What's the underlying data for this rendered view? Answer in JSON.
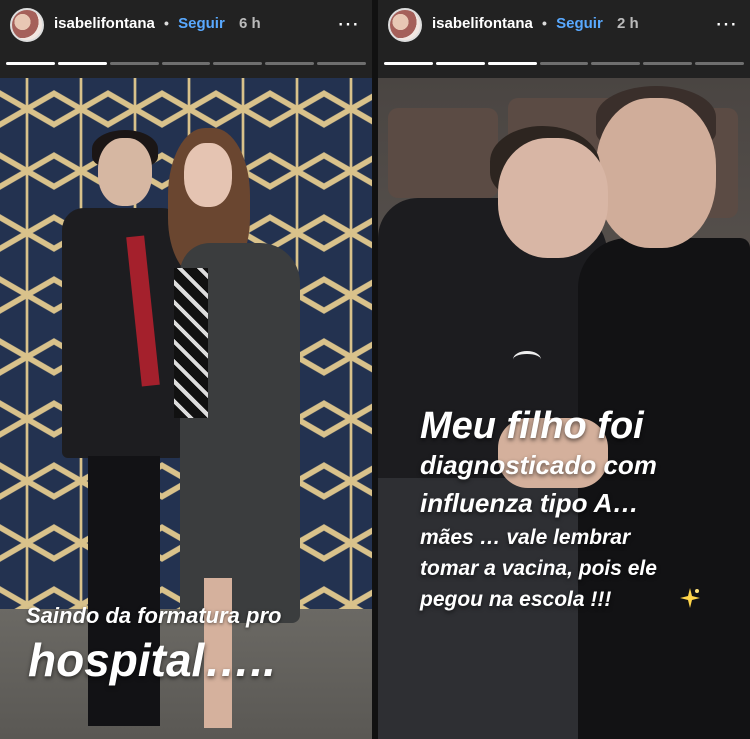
{
  "stories": [
    {
      "username": "isabelifontana",
      "follow_label": "Seguir",
      "time": "6 h",
      "more_icon": "⋯",
      "segments": 7,
      "done_segments": 2,
      "caption_line1": "Saindo da formatura pro",
      "caption_line2": "hospital….."
    },
    {
      "username": "isabelifontana",
      "follow_label": "Seguir",
      "time": "2 h",
      "more_icon": "⋯",
      "segments": 7,
      "done_segments": 3,
      "caption_lines": [
        "Meu filho foi",
        "diagnosticado com",
        "influenza tipo A…",
        "mães … vale lembrar",
        "tomar a vacina, pois ele",
        "pegou na escola !!!"
      ],
      "emoji": "sparkle-icon"
    }
  ],
  "colors": {
    "follow": "#59a9ff",
    "background": "#111111"
  }
}
